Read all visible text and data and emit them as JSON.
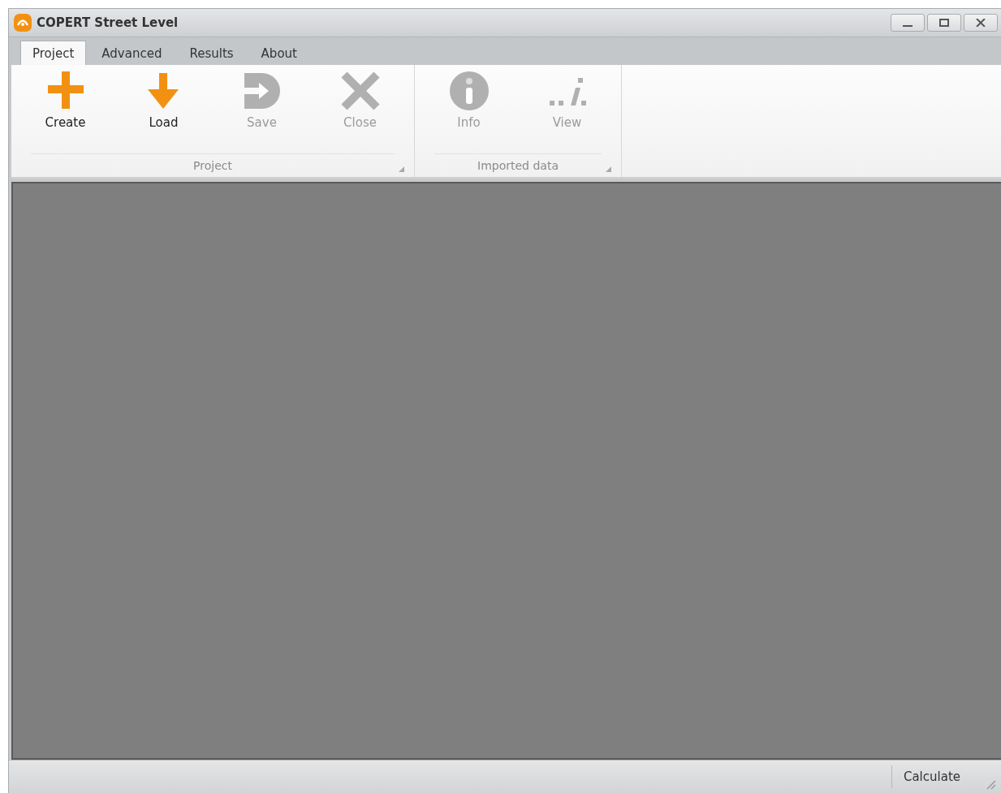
{
  "window": {
    "title": "COPERT Street Level"
  },
  "tabs": [
    {
      "label": "Project",
      "selected": true
    },
    {
      "label": "Advanced",
      "selected": false
    },
    {
      "label": "Results",
      "selected": false
    },
    {
      "label": "About",
      "selected": false
    }
  ],
  "ribbon_groups": [
    {
      "label": "Project",
      "items": [
        {
          "kind": "plus",
          "label": "Create",
          "disabled": false
        },
        {
          "kind": "down",
          "label": "Load",
          "disabled": false
        },
        {
          "kind": "save",
          "label": "Save",
          "disabled": true
        },
        {
          "kind": "cross",
          "label": "Close",
          "disabled": true
        }
      ]
    },
    {
      "label": "Imported data",
      "items": [
        {
          "kind": "info",
          "label": "Info",
          "disabled": true
        },
        {
          "kind": "dots",
          "label": "View",
          "disabled": true
        }
      ]
    }
  ],
  "status_bar": {
    "button": "Calculate"
  }
}
